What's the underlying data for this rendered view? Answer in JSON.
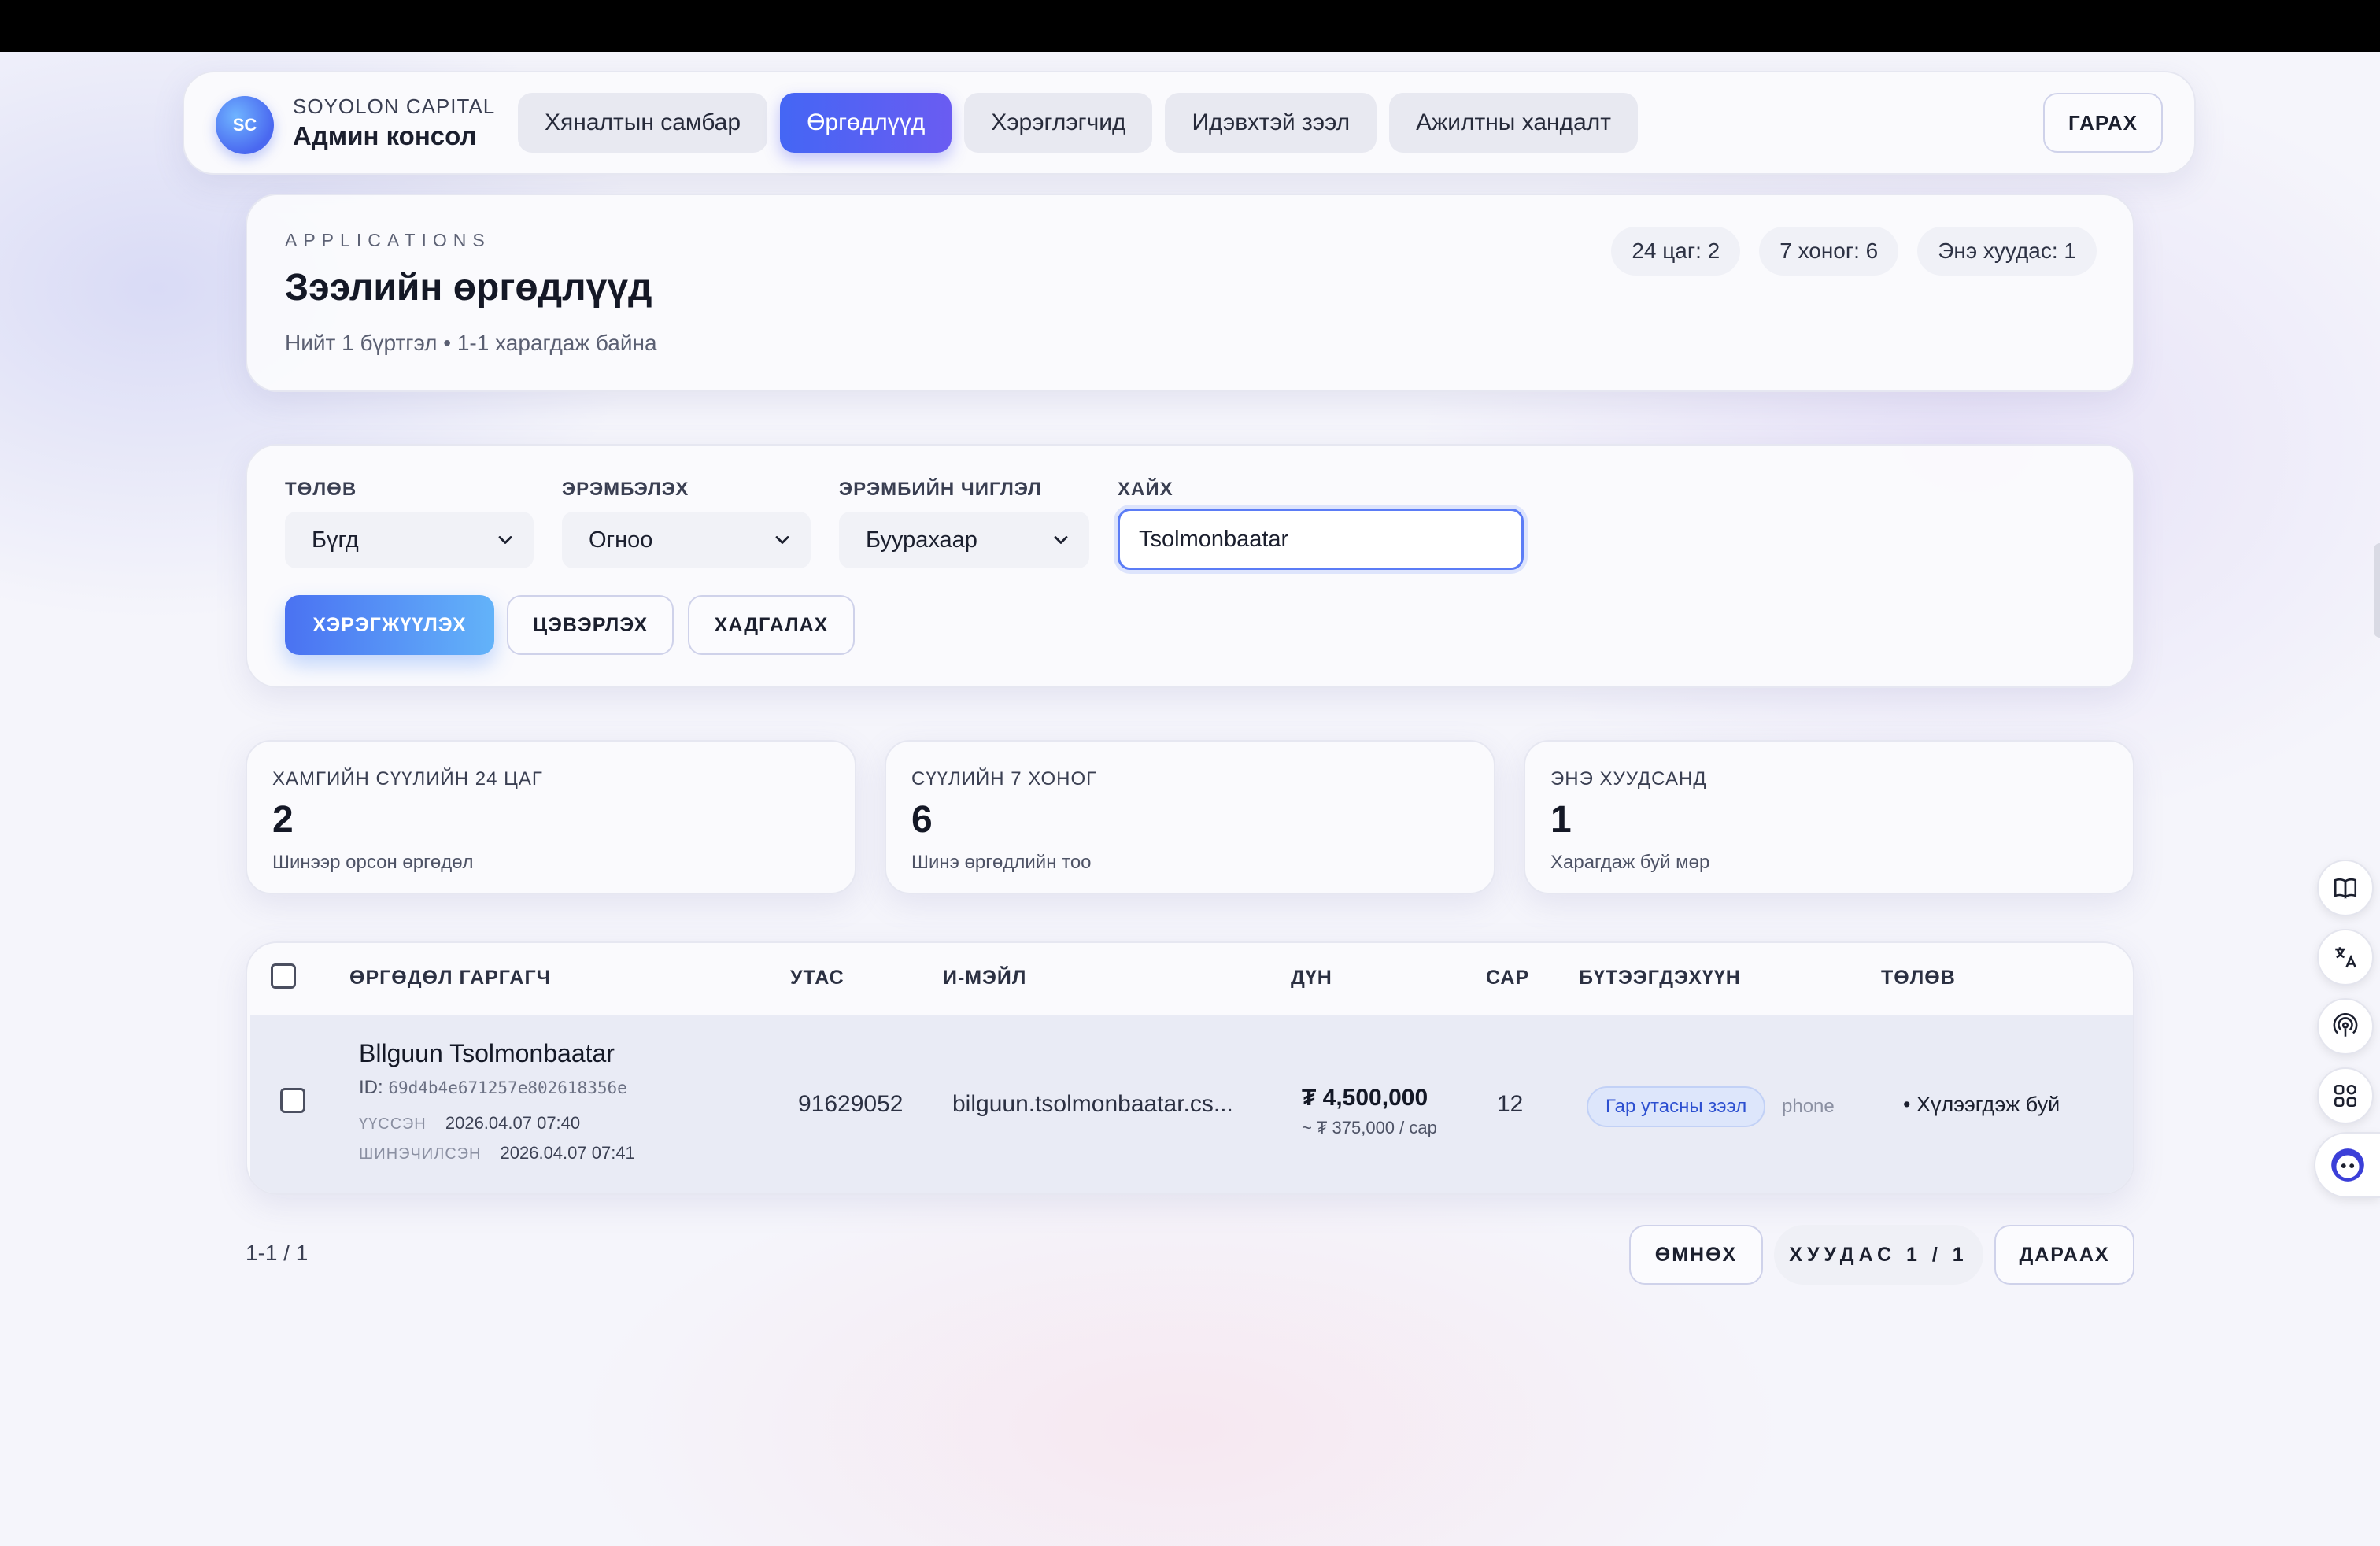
{
  "brand": {
    "initials": "SC",
    "company": "SOYOLON CAPITAL",
    "console": "Админ консол"
  },
  "nav": {
    "tabs": [
      {
        "label": "Хяналтын самбар",
        "active": false
      },
      {
        "label": "Өргөдлүүд",
        "active": true
      },
      {
        "label": "Хэрэглэгчид",
        "active": false
      },
      {
        "label": "Идэвхтэй зээл",
        "active": false
      },
      {
        "label": "Ажилтны хандалт",
        "active": false
      }
    ],
    "logout_label": "ГАРАХ"
  },
  "header": {
    "eyebrow": "APPLICATIONS",
    "title": "Зээлийн өргөдлүүд",
    "subtitle": "Нийт 1 бүртгэл • 1-1 харагдаж байна",
    "chips": [
      "24 цаг: 2",
      "7 хоног: 6",
      "Энэ хуудас: 1"
    ]
  },
  "filters": {
    "status": {
      "label": "ТӨЛӨВ",
      "value": "Бүгд"
    },
    "sort": {
      "label": "ЭРЭМБЭЛЭХ",
      "value": "Огноо"
    },
    "direction": {
      "label": "ЭРЭМБИЙН ЧИГЛЭЛ",
      "value": "Буурахаар"
    },
    "search": {
      "label": "ХАЙХ",
      "value": "Tsolmonbaatar"
    },
    "apply_label": "ХЭРЭГЖҮҮЛЭХ",
    "clear_label": "ЦЭВЭРЛЭХ",
    "save_label": "ХАДГАЛАХ"
  },
  "stats": [
    {
      "title": "ХАМГИЙН СҮҮЛИЙН 24 ЦАГ",
      "value": "2",
      "desc": "Шинээр орсон өргөдөл"
    },
    {
      "title": "СҮҮЛИЙН 7 ХОНОГ",
      "value": "6",
      "desc": "Шинэ өргөдлийн тоо"
    },
    {
      "title": "ЭНЭ ХУУДСАНД",
      "value": "1",
      "desc": "Харагдаж буй мөр"
    }
  ],
  "table": {
    "columns": {
      "applicant": "ӨРГӨДӨЛ ГАРГАГЧ",
      "phone": "УТАС",
      "email": "И-МЭЙЛ",
      "amount": "ДҮН",
      "months": "САР",
      "product": "БҮТЭЭГДЭХҮҮН",
      "status": "ТӨЛӨВ"
    },
    "rows": [
      {
        "name": "Bllguun Tsolmonbaatar",
        "id_label": "ID:",
        "id": "69d4b4e671257e802618356e",
        "created_label": "ҮҮССЭН",
        "created": "2026.04.07 07:40",
        "updated_label": "ШИНЭЧИЛСЭН",
        "updated": "2026.04.07 07:41",
        "phone": "91629052",
        "email": "bilguun.tsolmonbaatar.cs...",
        "amount": "₮ 4,500,000",
        "monthly": "~ ₮ 375,000 / сар",
        "months": "12",
        "product": "Гар утасны зээл",
        "product_type": "phone",
        "status": "• Хүлээгдэж буй"
      }
    ]
  },
  "pagination": {
    "count": "1-1 / 1",
    "prev_label": "ӨМНӨХ",
    "page_info": "ХУУДАС 1 / 1",
    "next_label": "ДАРААХ"
  },
  "colors": {
    "accent": "#4466f4",
    "accent2": "#6a5cf2",
    "pill_bg": "#dde6fb",
    "pill_text": "#2c4fd0"
  },
  "side_tools": [
    "book-icon",
    "translate-icon",
    "podcast-icon",
    "apps-icon",
    "assistant-icon"
  ]
}
